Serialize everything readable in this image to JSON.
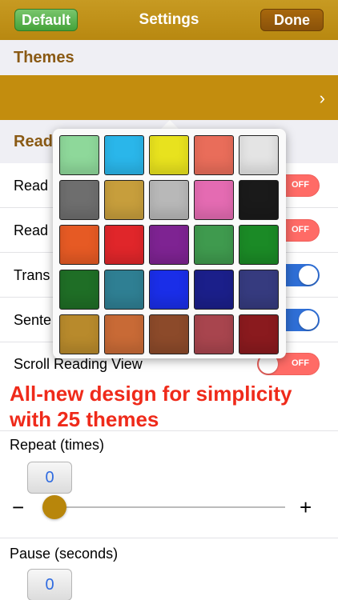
{
  "navbar": {
    "title": "Settings",
    "default_label": "Default",
    "done_label": "Done"
  },
  "themes_section": {
    "header": "Themes",
    "selected_color": "#c38d0e"
  },
  "reading_section": {
    "header": "Read",
    "rows": [
      {
        "label": "Read",
        "toggle_state": "off",
        "toggle_text": "OFF"
      },
      {
        "label": "Read",
        "toggle_state": "off",
        "toggle_text": "OFF"
      },
      {
        "label": "Trans",
        "toggle_state": "on",
        "toggle_text": ""
      },
      {
        "label": "Sente",
        "toggle_state": "on",
        "toggle_text": ""
      },
      {
        "label": "Scroll Reading View",
        "toggle_state": "off",
        "toggle_text": "OFF"
      }
    ]
  },
  "theme_palette": {
    "colors": [
      "#8ed89a",
      "#2ab6ea",
      "#e8e21e",
      "#e96d5a",
      "#e4e4e4",
      "#6e6e6e",
      "#c79e3c",
      "#b8b8b8",
      "#e46bb2",
      "#1a1a1a",
      "#e65a24",
      "#e0262a",
      "#7e2392",
      "#3f9a4e",
      "#1b8a26",
      "#1f6e26",
      "#2f7f93",
      "#1a2ee8",
      "#1b1f8a",
      "#363b7f",
      "#b88a2c",
      "#c86a36",
      "#8c4a2a",
      "#a8454e",
      "#8a1a1e"
    ]
  },
  "promo_text": {
    "line1": "All-new design for simplicity",
    "line2": "with 25 themes"
  },
  "repeat": {
    "label": "Repeat (times)",
    "value": "0",
    "minus": "−",
    "plus": "+",
    "slider_fraction": 0
  },
  "pause": {
    "label": "Pause (seconds)",
    "value": "0"
  }
}
